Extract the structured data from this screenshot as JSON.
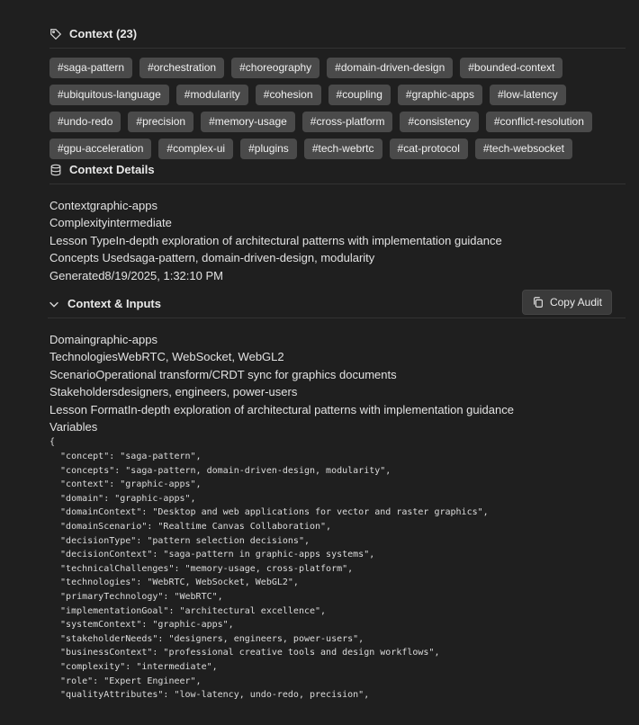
{
  "context_section": {
    "title": "Context (23)",
    "tags": [
      "#saga-pattern",
      "#orchestration",
      "#choreography",
      "#domain-driven-design",
      "#bounded-context",
      "#ubiquitous-language",
      "#modularity",
      "#cohesion",
      "#coupling",
      "#graphic-apps",
      "#low-latency",
      "#undo-redo",
      "#precision",
      "#memory-usage",
      "#cross-platform",
      "#consistency",
      "#conflict-resolution",
      "#gpu-acceleration",
      "#complex-ui",
      "#plugins",
      "#tech-webrtc",
      "#cat-protocol",
      "#tech-websocket"
    ]
  },
  "details_section": {
    "title": "Context Details",
    "rows": [
      "Contextgraphic-apps",
      "Complexityintermediate",
      "Lesson TypeIn-depth exploration of architectural patterns with implementation guidance",
      "Concepts Usedsaga-pattern, domain-driven-design, modularity",
      "Generated8/19/2025, 1:32:10 PM"
    ]
  },
  "inputs_section": {
    "title": "Context & Inputs",
    "copy_label": "Copy Audit",
    "rows": [
      "Domaingraphic-apps",
      "TechnologiesWebRTC, WebSocket, WebGL2",
      "ScenarioOperational transform/CRDT sync for graphics documents",
      "Stakeholdersdesigners, engineers, power-users",
      "Lesson FormatIn-depth exploration of architectural patterns with implementation guidance",
      "Variables"
    ],
    "code": "{\n  \"concept\": \"saga-pattern\",\n  \"concepts\": \"saga-pattern, domain-driven-design, modularity\",\n  \"context\": \"graphic-apps\",\n  \"domain\": \"graphic-apps\",\n  \"domainContext\": \"Desktop and web applications for vector and raster graphics\",\n  \"domainScenario\": \"Realtime Canvas Collaboration\",\n  \"decisionType\": \"pattern selection decisions\",\n  \"decisionContext\": \"saga-pattern in graphic-apps systems\",\n  \"technicalChallenges\": \"memory-usage, cross-platform\",\n  \"technologies\": \"WebRTC, WebSocket, WebGL2\",\n  \"primaryTechnology\": \"WebRTC\",\n  \"implementationGoal\": \"architectural excellence\",\n  \"systemContext\": \"graphic-apps\",\n  \"stakeholderNeeds\": \"designers, engineers, power-users\",\n  \"businessContext\": \"professional creative tools and design workflows\",\n  \"complexity\": \"intermediate\",\n  \"role\": \"Expert Engineer\",\n  \"qualityAttributes\": \"low-latency, undo-redo, precision\","
  }
}
